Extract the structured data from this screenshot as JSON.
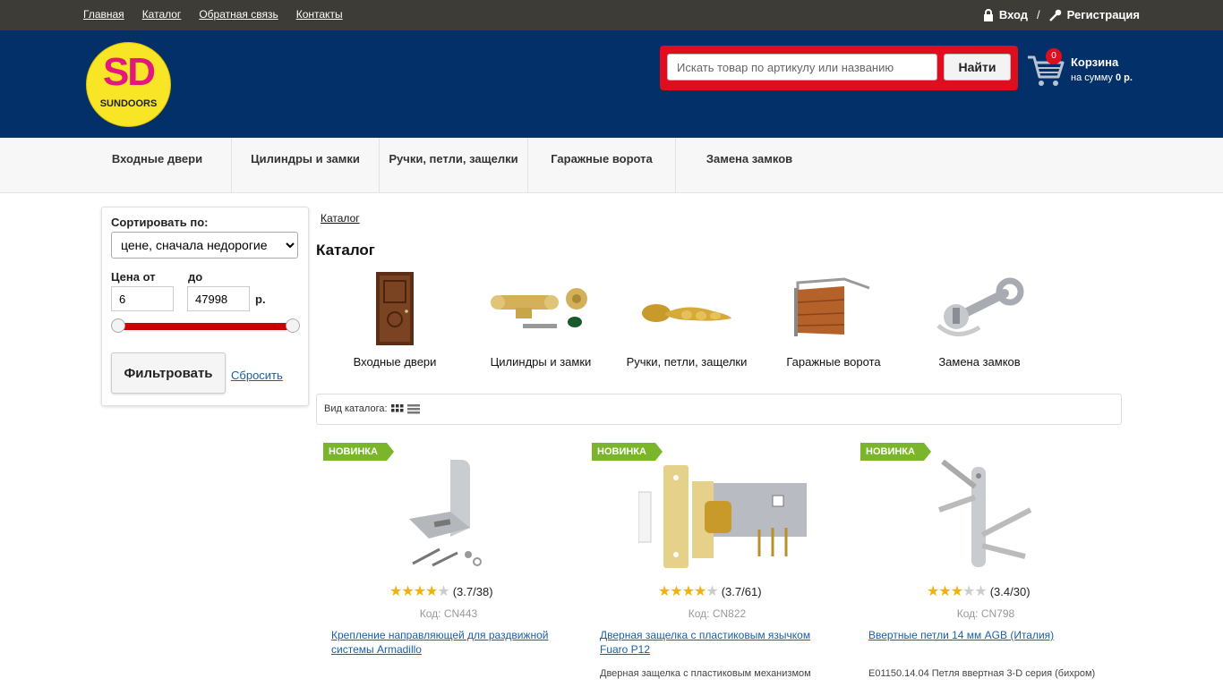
{
  "topbar": {
    "links": [
      "Главная",
      "Каталог",
      "Обратная связь",
      "Контакты"
    ],
    "login": "Вход",
    "separator": "/",
    "register": "Регистрация"
  },
  "header": {
    "logo_big": "SD",
    "logo_small": "SUNDOORS",
    "search_placeholder": "Искать товар по артикулу или названию",
    "search_button": "Найти",
    "cart_count": "0",
    "cart_title": "Корзина",
    "cart_sum_prefix": "на сумму",
    "cart_sum_value": "0 р."
  },
  "catnav": [
    "Входные двери",
    "Цилиндры и замки",
    "Ручки, петли, защелки",
    "Гаражные ворота",
    "Замена замков"
  ],
  "filter": {
    "sort_label": "Сортировать по:",
    "sort_value": "цене, сначала недорогие",
    "price_from_label": "Цена от",
    "price_to_label": "до",
    "price_from": "6",
    "price_to": "47998",
    "currency": "р.",
    "filter_button": "Фильтровать",
    "reset_link": "Сбросить"
  },
  "breadcrumb": "Каталог",
  "page_title": "Каталог",
  "categories": [
    "Входные двери",
    "Цилиндры и замки",
    "Ручки, петли, защелки",
    "Гаражные ворота",
    "Замена замков"
  ],
  "view_label": "Вид каталога:",
  "colors": {
    "accent_red": "#e00d1e",
    "header_blue": "#04306a",
    "new_badge": "#7ab52b",
    "star": "#f0b400"
  },
  "products": [
    {
      "badge": "НОВИНКА",
      "rating": "(3.7/38)",
      "stars": 3.7,
      "code": "Код: CN443",
      "title": "Крепление направляющей для раздвижной системы Armadillo",
      "desc": ""
    },
    {
      "badge": "НОВИНКА",
      "rating": "(3.7/61)",
      "stars": 3.7,
      "code": "Код: CN822",
      "title": "Дверная защелка с пластиковым язычком Fuaro P12",
      "desc": "Дверная защелка с пластиковым механизмом"
    },
    {
      "badge": "НОВИНКА",
      "rating": "(3.4/30)",
      "stars": 3.4,
      "code": "Код: CN798",
      "title": "Ввертные петли 14 мм AGB (Италия)",
      "desc": "E01150.14.04 Петля ввертная 3-D серия (бихром)"
    }
  ]
}
